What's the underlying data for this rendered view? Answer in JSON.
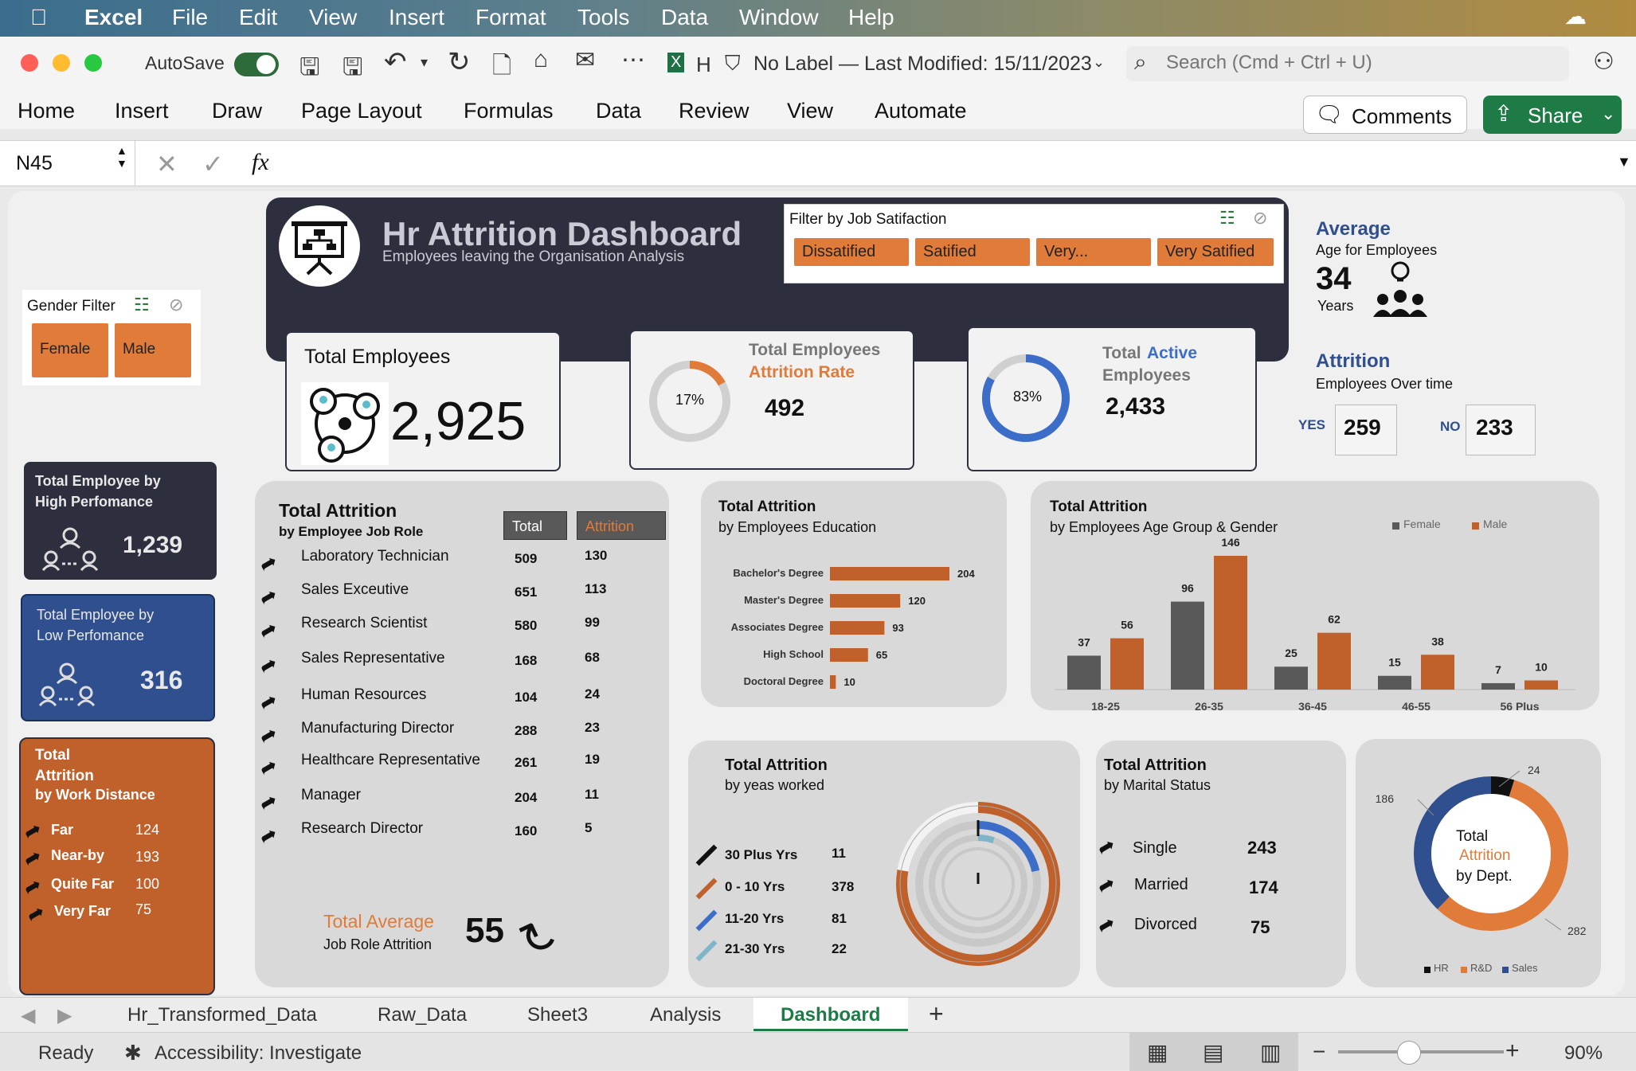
{
  "menubar": {
    "app": "Excel",
    "items": [
      "File",
      "Edit",
      "View",
      "Insert",
      "Format",
      "Tools",
      "Data",
      "Window",
      "Help"
    ]
  },
  "toolbar": {
    "autosave": "AutoSave",
    "doc_title": "H",
    "label_status": "No Label — Last Modified: 15/11/2023",
    "search_placeholder": "Search (Cmd + Ctrl + U)",
    "comments": "Comments",
    "share": "Share"
  },
  "ribbon": [
    "Home",
    "Insert",
    "Draw",
    "Page Layout",
    "Formulas",
    "Data",
    "Review",
    "View",
    "Automate"
  ],
  "formula": {
    "cell": "N45",
    "fx": "fx"
  },
  "dashboard": {
    "title": "Hr Attrition Dashboard",
    "subtitle": "Employees leaving the Organisation Analysis",
    "job_sat_filter": {
      "title": "Filter by Job Satifaction",
      "options": [
        "Dissatified",
        "Satified",
        "Very...",
        "Very Satified"
      ]
    },
    "gender_filter": {
      "title": "Gender Filter",
      "options": [
        "Female",
        "Male"
      ]
    },
    "total_employees": {
      "label": "Total Employees",
      "value": "2,925"
    },
    "attrition_rate": {
      "line1": "Total Employees",
      "line2": "Attrition Rate",
      "pct": "17%",
      "pct_value": 17,
      "value": "492"
    },
    "active": {
      "word1": "Total",
      "word2": "Active",
      "word3": "Employees",
      "pct": "83%",
      "pct_value": 83,
      "value": "2,433"
    },
    "average": {
      "title": "Average",
      "sub": "Age for Employees",
      "value": "34",
      "unit": "Years"
    },
    "attrition_time": {
      "title": "Attrition",
      "sub": "Employees Over time",
      "yes_label": "YES",
      "yes": "259",
      "no_label": "NO",
      "no": "233"
    },
    "high_perf": {
      "line1": "Total Employee by",
      "line2": "High Perfomance",
      "value": "1,239"
    },
    "low_perf": {
      "line1": "Total Employee by",
      "line2": "Low Perfomance",
      "value": "316"
    },
    "distance": {
      "line1": "Total",
      "line2": "Attrition",
      "line3": "by Work Distance",
      "rows": [
        {
          "k": "Far",
          "v": "124"
        },
        {
          "k": "Near-by",
          "v": "193"
        },
        {
          "k": "Quite Far",
          "v": "100"
        },
        {
          "k": "Very Far",
          "v": "75"
        }
      ]
    },
    "job_role": {
      "title": "Total Attrition",
      "sub": "by Employee Job Role",
      "col_total": "Total",
      "col_attr": "Attrition",
      "rows": [
        {
          "role": "Laboratory Technician",
          "total": "509",
          "attr": "130"
        },
        {
          "role": "Sales Exceutive",
          "total": "651",
          "attr": "113"
        },
        {
          "role": "Research Scientist",
          "total": "580",
          "attr": "99"
        },
        {
          "role": "Sales Representative",
          "total": "168",
          "attr": "68"
        },
        {
          "role": "Human Resources",
          "total": "104",
          "attr": "24"
        },
        {
          "role": "Manufacturing Director",
          "total": "288",
          "attr": "23"
        },
        {
          "role": "Healthcare Representative",
          "total": "261",
          "attr": "19"
        },
        {
          "role": "Manager",
          "total": "204",
          "attr": "11"
        },
        {
          "role": "Research Director",
          "total": "160",
          "attr": "5"
        }
      ],
      "avg_label": "Total Average",
      "avg_sub": "Job Role Attrition",
      "avg_value": "55"
    },
    "years_worked": {
      "title": "Total Attrition",
      "sub": "by yeas worked",
      "rows": [
        {
          "k": "30 Plus Yrs",
          "v": "11"
        },
        {
          "k": "0 - 10 Yrs",
          "v": "378"
        },
        {
          "k": "11-20 Yrs",
          "v": "81"
        },
        {
          "k": "21-30 Yrs",
          "v": "22"
        }
      ]
    },
    "marital": {
      "title": "Total Attrition",
      "sub": "by Marital Status",
      "rows": [
        {
          "k": "Single",
          "v": "243"
        },
        {
          "k": "Married",
          "v": "174"
        },
        {
          "k": "Divorced",
          "v": "75"
        }
      ]
    },
    "dept": {
      "line1": "Total",
      "line2": "Attrition",
      "line3": "by Dept."
    }
  },
  "chart_data": [
    {
      "type": "bar",
      "title": "Total Attrition",
      "subtitle": "by Employees Education",
      "orientation": "horizontal",
      "categories": [
        "Bachelor's Degree",
        "Master's Degree",
        "Associates Degree",
        "High School",
        "Doctoral Degree"
      ],
      "values": [
        204,
        120,
        93,
        65,
        10
      ],
      "color": "#c0602a"
    },
    {
      "type": "bar",
      "title": "Total Attrition",
      "subtitle": "by Employees Age Group & Gender",
      "categories": [
        "18-25",
        "26-35",
        "36-45",
        "46-55",
        "56 Plus"
      ],
      "series": [
        {
          "name": "Female",
          "values": [
            37,
            96,
            25,
            15,
            7
          ],
          "color": "#595959"
        },
        {
          "name": "Male",
          "values": [
            56,
            146,
            62,
            38,
            10
          ],
          "color": "#c0602a"
        }
      ],
      "legend": "top-right"
    },
    {
      "type": "pie",
      "title": "",
      "categories": [
        "HR",
        "R&D",
        "Sales"
      ],
      "values": [
        24,
        282,
        186
      ],
      "colors": [
        "#111111",
        "#e07b39",
        "#2f4f8f"
      ]
    }
  ],
  "sheet_tabs": [
    "Hr_Transformed_Data",
    "Raw_Data",
    "Sheet3",
    "Analysis",
    "Dashboard"
  ],
  "status": {
    "ready": "Ready",
    "accessibility": "Accessibility: Investigate",
    "zoom": "90%"
  }
}
